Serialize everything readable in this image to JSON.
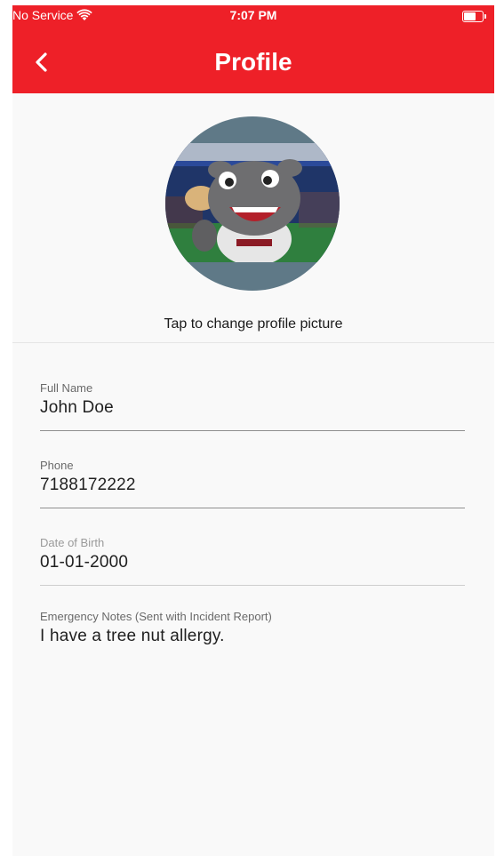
{
  "status_bar": {
    "carrier": "No Service",
    "time": "7:07 PM",
    "icons": [
      "wifi-icon",
      "battery-icon"
    ]
  },
  "header": {
    "title": "Profile",
    "back_icon": "chevron-left-icon"
  },
  "colors": {
    "header_background": "#ee2028",
    "screen_background": "#f9f9f9"
  },
  "profile": {
    "change_picture_label": "Tap to change profile picture"
  },
  "fields": [
    {
      "label": "Full Name",
      "value": "John Doe"
    },
    {
      "label": "Phone",
      "value": "7188172222"
    },
    {
      "label": "Date of Birth",
      "value": "01-01-2000"
    },
    {
      "label": "Emergency Notes (Sent with Incident Report)",
      "value": "I have a tree nut allergy."
    }
  ]
}
